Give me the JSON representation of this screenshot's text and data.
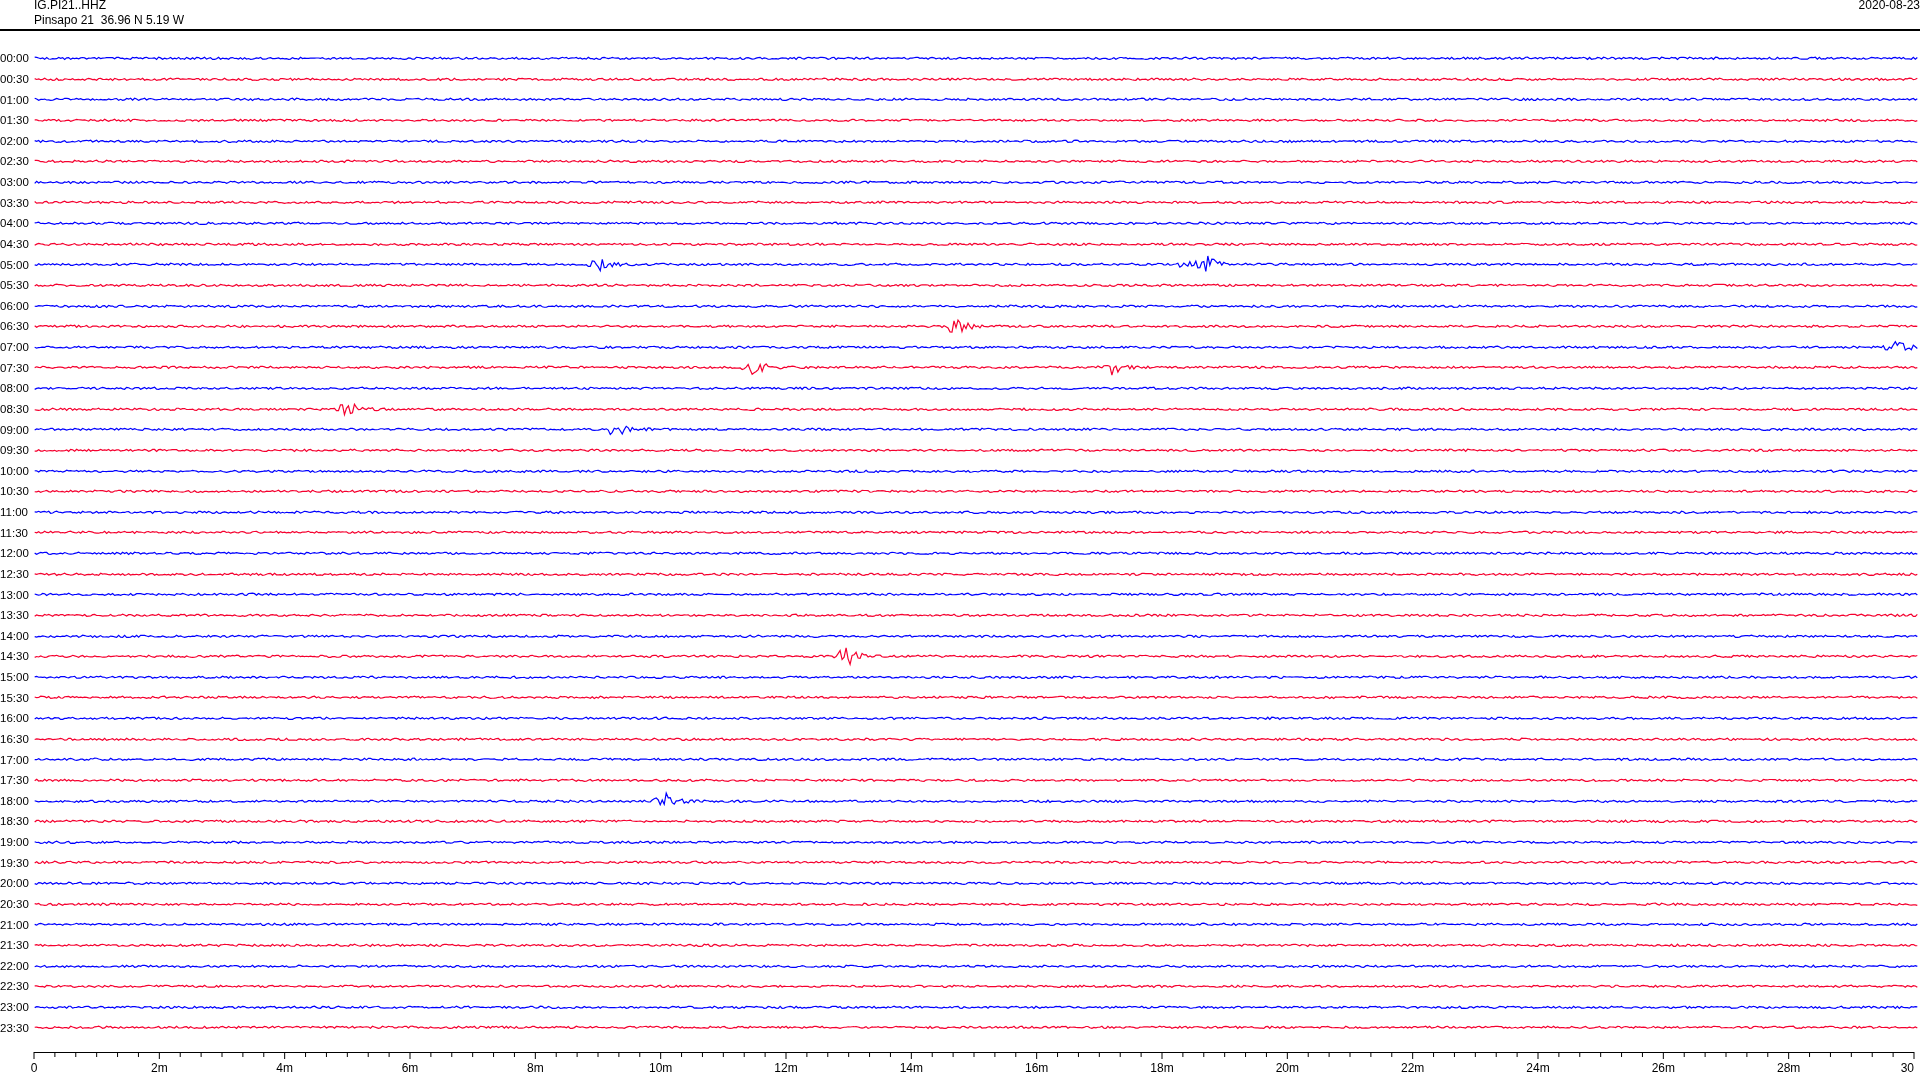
{
  "header": {
    "station_code": "IG.PI21..HHZ",
    "station_info": "Pinsapo 21  36.96 N 5.19 W",
    "date": "2020-08-23"
  },
  "traces": [
    {
      "label": "00:00",
      "color": "#0000ff"
    },
    {
      "label": "00:30",
      "color": "#f5002f"
    },
    {
      "label": "01:00",
      "color": "#0000ff"
    },
    {
      "label": "01:30",
      "color": "#f5002f"
    },
    {
      "label": "02:00",
      "color": "#0000ff"
    },
    {
      "label": "02:30",
      "color": "#f5002f"
    },
    {
      "label": "03:00",
      "color": "#0000ff"
    },
    {
      "label": "03:30",
      "color": "#f5002f"
    },
    {
      "label": "04:00",
      "color": "#0000ff"
    },
    {
      "label": "04:30",
      "color": "#f5002f"
    },
    {
      "label": "05:00",
      "color": "#0000ff"
    },
    {
      "label": "05:30",
      "color": "#f5002f"
    },
    {
      "label": "06:00",
      "color": "#0000ff"
    },
    {
      "label": "06:30",
      "color": "#f5002f"
    },
    {
      "label": "07:00",
      "color": "#0000ff"
    },
    {
      "label": "07:30",
      "color": "#f5002f"
    },
    {
      "label": "08:00",
      "color": "#0000ff"
    },
    {
      "label": "08:30",
      "color": "#f5002f"
    },
    {
      "label": "09:00",
      "color": "#0000ff"
    },
    {
      "label": "09:30",
      "color": "#f5002f"
    },
    {
      "label": "10:00",
      "color": "#0000ff"
    },
    {
      "label": "10:30",
      "color": "#f5002f"
    },
    {
      "label": "11:00",
      "color": "#0000ff"
    },
    {
      "label": "11:30",
      "color": "#f5002f"
    },
    {
      "label": "12:00",
      "color": "#0000ff"
    },
    {
      "label": "12:30",
      "color": "#f5002f"
    },
    {
      "label": "13:00",
      "color": "#0000ff"
    },
    {
      "label": "13:30",
      "color": "#f5002f"
    },
    {
      "label": "14:00",
      "color": "#0000ff"
    },
    {
      "label": "14:30",
      "color": "#f5002f"
    },
    {
      "label": "15:00",
      "color": "#0000ff"
    },
    {
      "label": "15:30",
      "color": "#f5002f"
    },
    {
      "label": "16:00",
      "color": "#0000ff"
    },
    {
      "label": "16:30",
      "color": "#f5002f"
    },
    {
      "label": "17:00",
      "color": "#0000ff"
    },
    {
      "label": "17:30",
      "color": "#f5002f"
    },
    {
      "label": "18:00",
      "color": "#0000ff"
    },
    {
      "label": "18:30",
      "color": "#f5002f"
    },
    {
      "label": "19:00",
      "color": "#0000ff"
    },
    {
      "label": "19:30",
      "color": "#f5002f"
    },
    {
      "label": "20:00",
      "color": "#0000ff"
    },
    {
      "label": "20:30",
      "color": "#f5002f"
    },
    {
      "label": "21:00",
      "color": "#0000ff"
    },
    {
      "label": "21:30",
      "color": "#f5002f"
    },
    {
      "label": "22:00",
      "color": "#0000ff"
    },
    {
      "label": "22:30",
      "color": "#f5002f"
    },
    {
      "label": "23:00",
      "color": "#0000ff"
    },
    {
      "label": "23:30",
      "color": "#f5002f"
    }
  ],
  "time_axis": {
    "ticks": [
      "0",
      "2m",
      "4m",
      "6m",
      "8m",
      "10m",
      "12m",
      "14m",
      "16m",
      "18m",
      "20m",
      "22m",
      "24m",
      "26m",
      "28m",
      "30"
    ]
  }
}
